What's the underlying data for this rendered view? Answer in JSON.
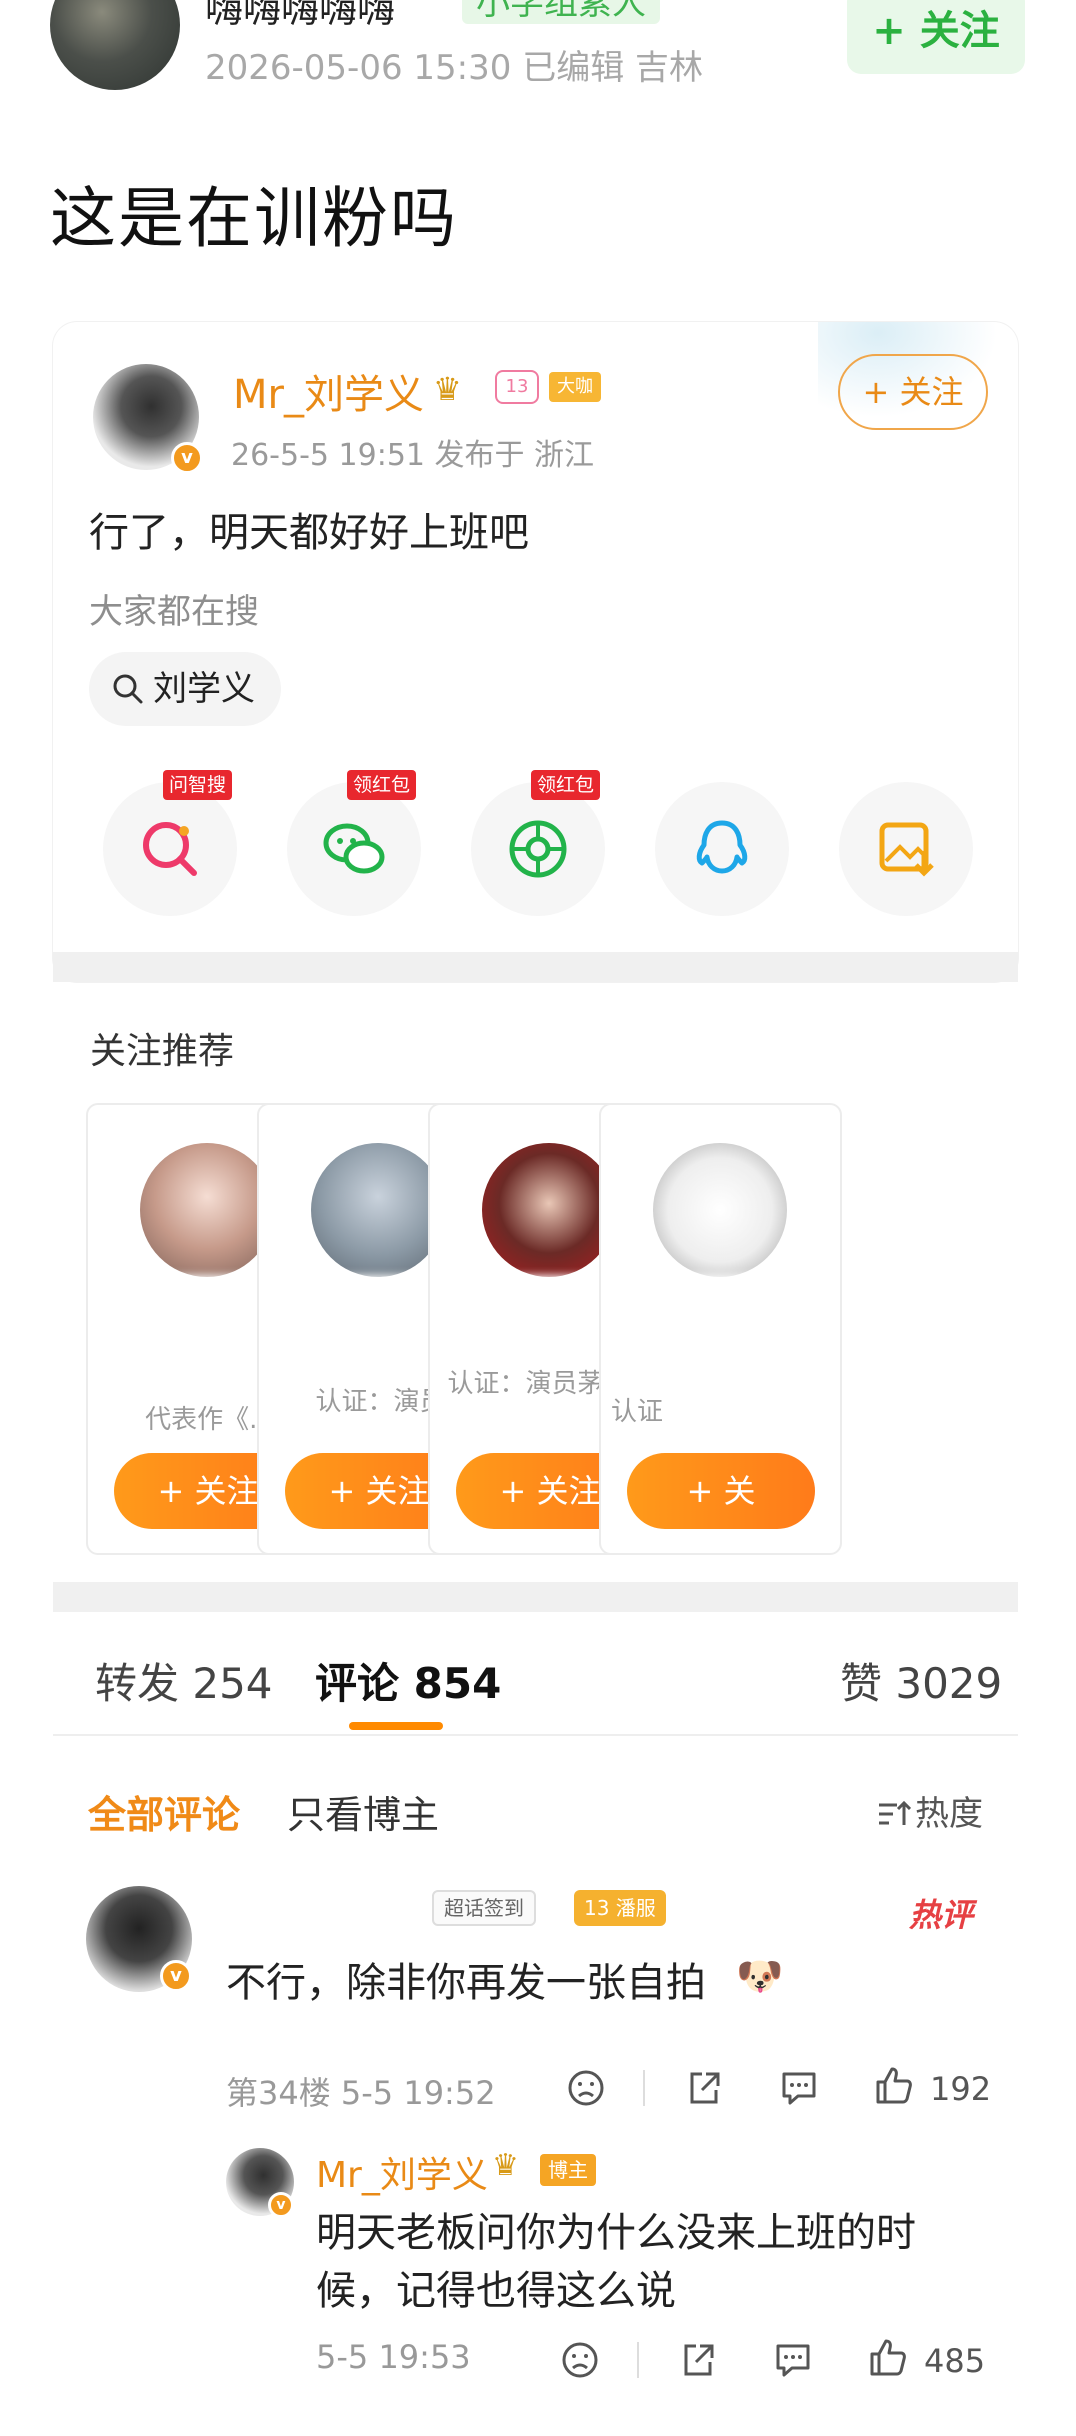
{
  "outer_post": {
    "author": "嗨嗨嗨嗨嗨",
    "tag": "小学组素人",
    "meta": "2026-05-06 15:30 已编辑 吉林",
    "follow_label": "+ 关注",
    "title": "这是在训粉吗"
  },
  "card": {
    "poster_name": "Mr_刘学义",
    "level_badge": "13",
    "big_badge": "大咖",
    "meta": "26-5-5 19:51 发布于 浙江",
    "follow_label": "+ 关注",
    "text": "行了，明天都好好上班吧",
    "search_hint": "大家都在搜",
    "search_chip": "刘学义",
    "share": [
      {
        "icon": "qa-search-icon",
        "label": "问智搜"
      },
      {
        "icon": "wechat-icon",
        "label": "领红包"
      },
      {
        "icon": "moments-icon",
        "label": "领红包"
      },
      {
        "icon": "qq-icon",
        "label": ""
      },
      {
        "icon": "save-image-icon",
        "label": ""
      }
    ]
  },
  "recommend": {
    "title": "关注推荐",
    "cards": [
      {
        "desc": "代表作《...",
        "follow_label": "+ 关注"
      },
      {
        "desc": "认证：演员",
        "follow_label": "+ 关注"
      },
      {
        "desc": "认证：演员茅子俊",
        "follow_label": "+ 关注"
      },
      {
        "desc": "认证",
        "follow_label": "+ 关"
      }
    ]
  },
  "tabs": {
    "repost": "转发 254",
    "comment": "评论 854",
    "like": "赞 3029"
  },
  "filters": {
    "all": "全部评论",
    "only_op": "只看博主",
    "sort": "热度"
  },
  "comment": {
    "badge_checkin": "超话签到",
    "badge_level": "13 潘服",
    "hot": "热评",
    "text": "不行，除非你再发一张自拍",
    "meta": "第34楼 5-5 19:52",
    "likes": "192"
  },
  "reply": {
    "name": "Mr_刘学义",
    "host_badge": "博主",
    "text": "明天老板问你为什么没来上班的时候，记得也得这么说",
    "meta": "5-5 19:53",
    "likes": "485"
  },
  "colors": {
    "brand_orange": "#ff8a00",
    "follow_green": "#2bb140",
    "hot_red": "#e64043"
  }
}
